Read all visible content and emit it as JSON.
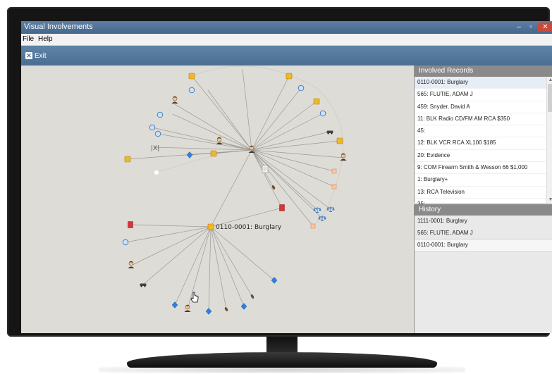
{
  "window": {
    "title": "Visual Involvements",
    "min": "–",
    "max": "▫",
    "close": "✕"
  },
  "menu": {
    "file": "File",
    "help": "Help"
  },
  "toolbar": {
    "exit_label": "Exit"
  },
  "graph": {
    "focus_label": "0110-0001: Burglary"
  },
  "involved_records": {
    "header": "Involved Records",
    "items": [
      "0110-0001: Burglary",
      "565: FLUTIE, ADAM J",
      "459: Snyder, David A",
      "11: BLK Radio CD/FM AM RCA $350",
      "45:",
      "12: BLK VCR RCA XL100 $185",
      "20: Evidence",
      "9: COM Firearm Smith & Wesson 66 $1,000",
      "1: Burglary+",
      "13: RCA Television",
      "35:"
    ]
  },
  "history": {
    "header": "History",
    "items": [
      "1111-0001: Burglary",
      "565: FLUTIE, ADAM J",
      "0110-0001: Burglary"
    ]
  }
}
